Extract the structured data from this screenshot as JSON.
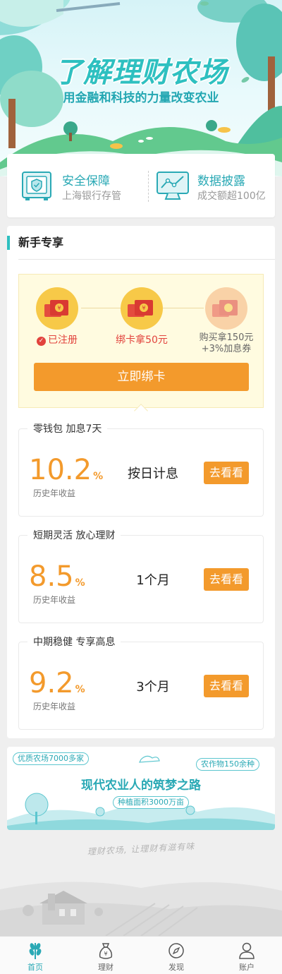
{
  "hero": {
    "title": "了解理财农场",
    "subtitle": "用金融和科技的力量改变农业"
  },
  "features": [
    {
      "title": "安全保障",
      "desc": "上海银行存管",
      "icon": "safe-box-icon"
    },
    {
      "title": "数据披露",
      "desc": "成交额超100亿",
      "icon": "monitor-chart-icon"
    }
  ],
  "newbie": {
    "section_title": "新手专享",
    "steps": [
      {
        "label": "已注册",
        "state": "done"
      },
      {
        "label": "绑卡拿50元",
        "state": "current"
      },
      {
        "label_line1": "购买拿150元",
        "label_line2": "+3%加息券",
        "state": "pending"
      }
    ],
    "bind_button": "立即绑卡"
  },
  "products": [
    {
      "tag": "零钱包 加息7天",
      "rate": "10.2",
      "unit": "%",
      "rate_label": "历史年收益",
      "period": "按日计息",
      "button": "去看看"
    },
    {
      "tag": "短期灵活 放心理财",
      "rate": "8.5",
      "unit": "%",
      "rate_label": "历史年收益",
      "period": "1个月",
      "button": "去看看"
    },
    {
      "tag": "中期稳健 专享高息",
      "rate": "9.2",
      "unit": "%",
      "rate_label": "历史年收益",
      "period": "3个月",
      "button": "去看看"
    }
  ],
  "banner": {
    "tag_left": "优质农场7000多家",
    "tag_right": "农作物150余种",
    "title": "现代农业人的筑梦之路",
    "tag_bottom": "种植面积3000万亩"
  },
  "footer": {
    "slogan": "理财农场, 让理财有滋有味"
  },
  "tabbar": [
    {
      "label": "首页",
      "icon": "wheat-icon",
      "active": true
    },
    {
      "label": "理财",
      "icon": "money-bag-icon",
      "active": false
    },
    {
      "label": "发现",
      "icon": "compass-icon",
      "active": false
    },
    {
      "label": "账户",
      "icon": "user-icon",
      "active": false
    }
  ],
  "colors": {
    "accent_teal": "#2ec0c0",
    "accent_orange": "#f39a2c",
    "accent_red": "#e2433d"
  }
}
